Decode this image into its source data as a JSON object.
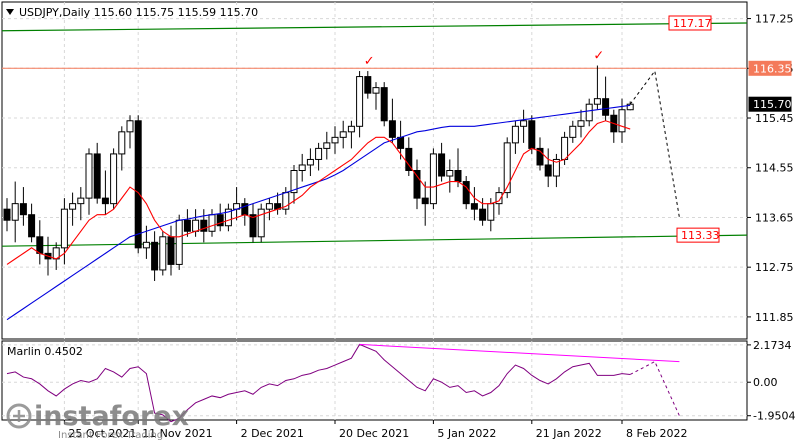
{
  "chart_data": [
    {
      "type": "candlestick",
      "symbol_line": "USDJPY,Daily  115.60 115.75 115.59 115.70",
      "ylim": [
        111.45,
        117.55
      ],
      "y_ticks": [
        "117.25",
        "116.35",
        "115.45",
        "114.55",
        "113.65",
        "112.75",
        "111.85"
      ],
      "price_tags": [
        {
          "text": "117.17",
          "value": 117.17,
          "color": "#ff0000",
          "filled": false
        },
        {
          "text": "116.35",
          "value": 116.35,
          "color": "#f47a5a",
          "filled": true
        },
        {
          "text": "115.70",
          "value": 115.7,
          "color": "#000000",
          "filled": true
        },
        {
          "text": "113.33",
          "value": 113.33,
          "color": "#ff0000",
          "filled": false
        }
      ],
      "channel_lines": [
        {
          "name": "",
          "color": "#008000",
          "from": [
            0,
            117.03
          ],
          "to": [
            83,
            117.17
          ]
        },
        {
          "name": "",
          "color": "#008000",
          "from": [
            0,
            113.13
          ],
          "to": [
            83,
            113.33
          ]
        }
      ],
      "horizontal_levels": [
        {
          "value": 116.35,
          "color": "#f47a5a"
        }
      ],
      "candles": [
        [
          113.8,
          114.0,
          113.4,
          113.6
        ],
        [
          113.6,
          114.3,
          113.2,
          113.9
        ],
        [
          113.9,
          114.2,
          113.5,
          113.7
        ],
        [
          113.7,
          113.9,
          113.2,
          113.3
        ],
        [
          113.3,
          113.6,
          112.8,
          113.0
        ],
        [
          113.0,
          113.3,
          112.6,
          112.9
        ],
        [
          112.9,
          113.2,
          112.7,
          113.1
        ],
        [
          113.1,
          114.0,
          112.8,
          113.8
        ],
        [
          113.8,
          114.1,
          113.5,
          113.9
        ],
        [
          113.9,
          114.2,
          113.6,
          114.0
        ],
        [
          114.0,
          114.9,
          113.7,
          114.8
        ],
        [
          114.8,
          115.0,
          113.9,
          114.0
        ],
        [
          114.0,
          114.5,
          113.7,
          113.9
        ],
        [
          113.9,
          114.9,
          113.8,
          114.8
        ],
        [
          114.8,
          115.3,
          114.5,
          115.2
        ],
        [
          115.2,
          115.5,
          114.9,
          115.4
        ],
        [
          115.4,
          115.5,
          113.0,
          113.1
        ],
        [
          113.1,
          113.5,
          112.9,
          113.2
        ],
        [
          113.2,
          113.4,
          112.5,
          112.7
        ],
        [
          112.7,
          113.4,
          112.6,
          113.3
        ],
        [
          113.3,
          113.5,
          112.6,
          112.8
        ],
        [
          112.8,
          113.7,
          112.7,
          113.6
        ],
        [
          113.6,
          113.8,
          113.3,
          113.4
        ],
        [
          113.4,
          113.8,
          113.3,
          113.6
        ],
        [
          113.6,
          113.8,
          113.2,
          113.4
        ],
        [
          113.4,
          113.8,
          113.3,
          113.7
        ],
        [
          113.7,
          113.9,
          113.4,
          113.5
        ],
        [
          113.5,
          113.9,
          113.4,
          113.8
        ],
        [
          113.8,
          114.2,
          113.6,
          113.9
        ],
        [
          113.9,
          114.0,
          113.5,
          113.7
        ],
        [
          113.7,
          113.9,
          113.2,
          113.3
        ],
        [
          113.3,
          113.9,
          113.2,
          113.8
        ],
        [
          113.8,
          114.0,
          113.6,
          113.9
        ],
        [
          113.9,
          114.1,
          113.7,
          113.8
        ],
        [
          113.8,
          114.2,
          113.7,
          114.1
        ],
        [
          114.1,
          114.6,
          113.9,
          114.5
        ],
        [
          114.5,
          114.8,
          114.3,
          114.6
        ],
        [
          114.6,
          114.9,
          114.4,
          114.7
        ],
        [
          114.7,
          115.0,
          114.5,
          114.9
        ],
        [
          114.9,
          115.2,
          114.7,
          115.0
        ],
        [
          115.0,
          115.3,
          114.8,
          115.1
        ],
        [
          115.1,
          115.4,
          114.9,
          115.2
        ],
        [
          115.2,
          115.4,
          114.9,
          115.3
        ],
        [
          115.3,
          116.3,
          115.1,
          116.2
        ],
        [
          116.2,
          116.3,
          115.8,
          115.9
        ],
        [
          115.9,
          116.1,
          115.6,
          116.0
        ],
        [
          116.0,
          116.1,
          115.3,
          115.4
        ],
        [
          115.4,
          115.8,
          115.0,
          115.1
        ],
        [
          115.1,
          115.4,
          114.7,
          114.9
        ],
        [
          114.9,
          115.1,
          114.4,
          114.5
        ],
        [
          114.5,
          114.7,
          113.8,
          114.0
        ],
        [
          114.0,
          114.3,
          113.5,
          113.9
        ],
        [
          113.9,
          114.9,
          113.8,
          114.8
        ],
        [
          114.8,
          115.0,
          114.3,
          114.4
        ],
        [
          114.4,
          114.7,
          114.1,
          114.5
        ],
        [
          114.5,
          114.9,
          114.2,
          114.3
        ],
        [
          114.3,
          114.4,
          113.8,
          113.9
        ],
        [
          113.9,
          114.2,
          113.6,
          113.8
        ],
        [
          113.8,
          114.0,
          113.5,
          113.6
        ],
        [
          113.6,
          114.0,
          113.4,
          113.9
        ],
        [
          113.9,
          114.2,
          113.7,
          114.1
        ],
        [
          114.1,
          115.1,
          114.0,
          115.0
        ],
        [
          115.0,
          115.4,
          114.8,
          115.3
        ],
        [
          115.3,
          115.6,
          115.0,
          115.4
        ],
        [
          115.4,
          115.5,
          114.8,
          114.9
        ],
        [
          114.9,
          115.1,
          114.5,
          114.6
        ],
        [
          114.6,
          114.9,
          114.2,
          114.4
        ],
        [
          114.4,
          114.8,
          114.2,
          114.7
        ],
        [
          114.7,
          115.2,
          114.6,
          115.1
        ],
        [
          115.1,
          115.4,
          115.0,
          115.3
        ],
        [
          115.3,
          115.6,
          115.1,
          115.4
        ],
        [
          115.4,
          115.8,
          115.3,
          115.7
        ],
        [
          115.7,
          116.4,
          115.6,
          115.8
        ],
        [
          115.8,
          116.2,
          115.4,
          115.5
        ],
        [
          115.5,
          115.6,
          115.0,
          115.2
        ],
        [
          115.2,
          115.8,
          115.0,
          115.6
        ],
        [
          115.6,
          115.75,
          115.59,
          115.7
        ]
      ],
      "ma_fast_color": "#ff0000",
      "ma_fast": [
        112.8,
        112.9,
        113.0,
        113.1,
        113.0,
        112.95,
        112.9,
        113.0,
        113.2,
        113.4,
        113.6,
        113.7,
        113.7,
        113.8,
        114.0,
        114.2,
        114.1,
        113.9,
        113.6,
        113.4,
        113.3,
        113.3,
        113.35,
        113.4,
        113.45,
        113.5,
        113.55,
        113.6,
        113.65,
        113.7,
        113.65,
        113.7,
        113.75,
        113.8,
        113.85,
        113.95,
        114.05,
        114.2,
        114.3,
        114.4,
        114.5,
        114.6,
        114.7,
        114.85,
        115.0,
        115.1,
        115.1,
        115.0,
        114.8,
        114.6,
        114.4,
        114.2,
        114.2,
        114.25,
        114.3,
        114.3,
        114.2,
        114.0,
        113.9,
        113.9,
        113.95,
        114.2,
        114.5,
        114.8,
        114.9,
        114.85,
        114.7,
        114.65,
        114.7,
        114.85,
        115.0,
        115.2,
        115.35,
        115.4,
        115.35,
        115.3,
        115.25
      ],
      "ma_slow_color": "#0000dd",
      "ma_slow": [
        111.8,
        111.9,
        112.0,
        112.1,
        112.2,
        112.3,
        112.4,
        112.5,
        112.6,
        112.7,
        112.8,
        112.9,
        113.0,
        113.1,
        113.2,
        113.3,
        113.35,
        113.4,
        113.45,
        113.5,
        113.55,
        113.6,
        113.62,
        113.65,
        113.68,
        113.7,
        113.72,
        113.75,
        113.8,
        113.85,
        113.9,
        113.95,
        114.0,
        114.05,
        114.1,
        114.15,
        114.2,
        114.25,
        114.3,
        114.35,
        114.42,
        114.5,
        114.6,
        114.7,
        114.8,
        114.9,
        115.0,
        115.05,
        115.1,
        115.15,
        115.2,
        115.22,
        115.25,
        115.28,
        115.3,
        115.3,
        115.3,
        115.3,
        115.32,
        115.34,
        115.36,
        115.38,
        115.4,
        115.42,
        115.44,
        115.46,
        115.48,
        115.5,
        115.52,
        115.54,
        115.56,
        115.58,
        115.6,
        115.62,
        115.64,
        115.66,
        115.68
      ],
      "forecast_dashed": [
        [
          76,
          115.7
        ],
        [
          79,
          116.3
        ],
        [
          82,
          113.65
        ]
      ],
      "top_markers": [
        {
          "index": 44,
          "price": 116.3,
          "symbol": "✓",
          "color": "#ff0000"
        },
        {
          "index": 72,
          "price": 116.4,
          "symbol": "✓",
          "color": "#ff0000"
        }
      ],
      "x_labels": [
        {
          "index": 7,
          "text": "25 Oct 2021"
        },
        {
          "index": 16,
          "text": "11 Nov 2021"
        },
        {
          "index": 28,
          "text": "2 Dec 2021"
        },
        {
          "index": 40,
          "text": "20 Dec 2021"
        },
        {
          "index": 52,
          "text": "5 Jan 2022"
        },
        {
          "index": 64,
          "text": "21 Jan 2022"
        },
        {
          "index": 75,
          "text": "8 Feb 2022"
        }
      ]
    },
    {
      "type": "line",
      "title": "Marlin 0.4502",
      "ylim": [
        -2.2,
        2.4
      ],
      "y_ticks": [
        "2.1734",
        "0.00",
        "-1.9504"
      ],
      "series": [
        {
          "color": "#800080",
          "values": [
            0.5,
            0.6,
            0.3,
            0.2,
            -0.1,
            -0.5,
            -0.8,
            -0.4,
            -0.1,
            0.1,
            0.0,
            0.2,
            0.8,
            0.6,
            0.3,
            0.8,
            0.9,
            0.5,
            -1.8,
            -1.9,
            -2.3,
            -2.1,
            -1.6,
            -1.2,
            -1.0,
            -0.8,
            -0.9,
            -0.7,
            -0.6,
            -0.5,
            -0.7,
            -0.3,
            -0.1,
            -0.2,
            0.1,
            0.2,
            0.4,
            0.5,
            0.7,
            0.8,
            1.0,
            1.2,
            1.4,
            2.2,
            2.0,
            1.8,
            1.3,
            0.9,
            0.5,
            0.1,
            -0.3,
            -0.5,
            0.2,
            0.0,
            -0.3,
            -0.2,
            -0.6,
            -0.5,
            -0.8,
            -0.6,
            -0.2,
            0.5,
            1.0,
            0.8,
            0.4,
            0.1,
            -0.1,
            0.2,
            0.6,
            0.9,
            1.0,
            1.1,
            0.4,
            0.4,
            0.4,
            0.5,
            0.45
          ]
        },
        {
          "color": "#800080",
          "dashed": true,
          "points": [
            [
              76,
              0.45
            ],
            [
              79,
              1.2
            ],
            [
              82,
              -1.95
            ]
          ]
        },
        {
          "color": "#ff00ff",
          "points": [
            [
              43,
              2.2
            ],
            [
              82,
              1.2
            ]
          ]
        }
      ]
    }
  ],
  "watermark": {
    "brand": "instaforex",
    "tagline": "Instant Forex Trading"
  }
}
